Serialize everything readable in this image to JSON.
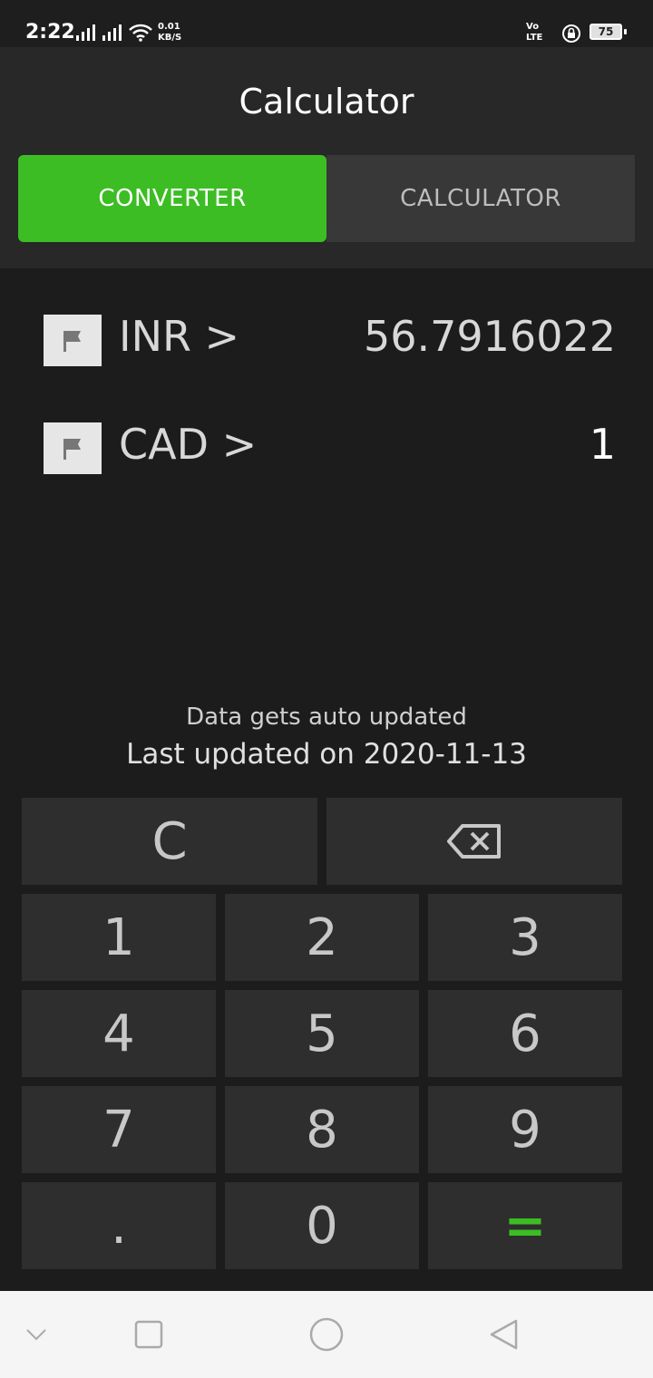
{
  "status": {
    "time": "2:22",
    "net_speed_value": "0.01",
    "net_speed_unit": "KB/S",
    "volte_top": "Vo",
    "volte_bottom": "LTE",
    "battery": "75"
  },
  "header": {
    "title": "Calculator",
    "tabs": [
      {
        "label": "CONVERTER",
        "active": true
      },
      {
        "label": "CALCULATOR",
        "active": false
      }
    ]
  },
  "currencies": [
    {
      "code": "INR >",
      "value": "56.7916022",
      "value_color": "#d8d8d8"
    },
    {
      "code": "CAD >",
      "value": "1",
      "value_color": "#ffffff"
    }
  ],
  "info": {
    "auto_update": "Data gets auto updated",
    "last_updated": "Last updated on 2020-11-13"
  },
  "keypad": {
    "clear": "C",
    "backspace_icon": "backspace-icon",
    "keys": [
      "1",
      "2",
      "3",
      "4",
      "5",
      "6",
      "7",
      "8",
      "9",
      ".",
      "0",
      "="
    ]
  },
  "colors": {
    "accent": "#3cbd24",
    "background": "#1c1c1c"
  }
}
